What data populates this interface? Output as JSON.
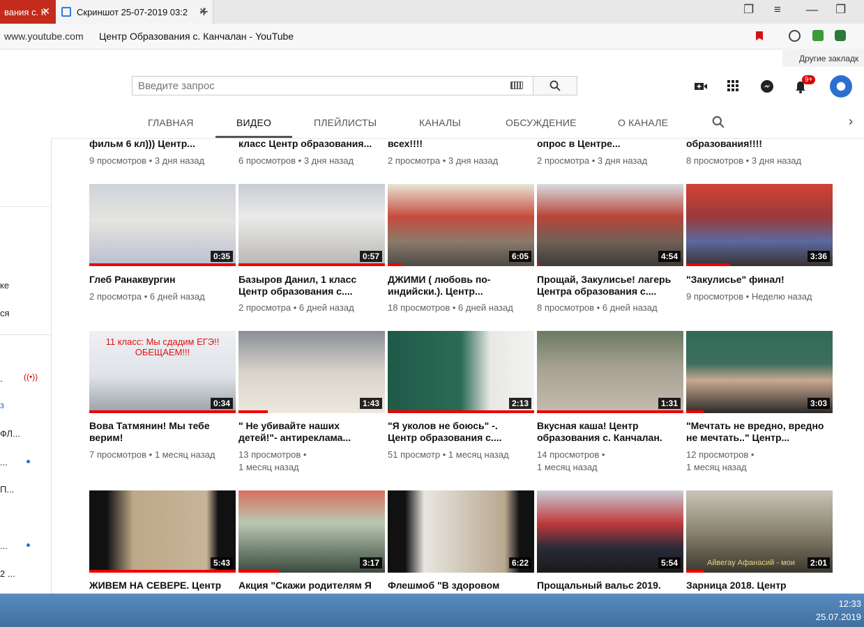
{
  "browser": {
    "tabs": [
      {
        "label": "вания с. К"
      },
      {
        "label": "Скриншот 25-07-2019 03:2"
      }
    ],
    "address": {
      "domain": "www.youtube.com",
      "title": "Центр Образования с. Канчалан - YouTube"
    },
    "other_bookmarks": "Другие закладк"
  },
  "masthead": {
    "search_placeholder": "Введите запрос",
    "notif_count": "9+"
  },
  "sidebar": {
    "items": [
      "ке",
      "ся",
      ".",
      "з",
      "ФЛ...",
      "...",
      "П...",
      "...",
      "2 ..."
    ]
  },
  "channel_tabs": [
    "ГЛАВНАЯ",
    "ВИДЕО",
    "ПЛЕЙЛИСТЫ",
    "КАНАЛЫ",
    "ОБСУЖДЕНИЕ",
    "О КАНАЛЕ"
  ],
  "partial_row": [
    {
      "title": "фильм 6 кл))) Центр...",
      "meta": "9 просмотров • 3 дня назад"
    },
    {
      "title": "класс Центр образования...",
      "meta": "6 просмотров • 3 дня назад"
    },
    {
      "title": "всех!!!!",
      "meta": "2 просмотра • 3 дня назад"
    },
    {
      "title": "опрос в Центре...",
      "meta": "2 просмотра • 3 дня назад"
    },
    {
      "title": "образования!!!!",
      "meta": "8 просмотров • 3 дня назад"
    }
  ],
  "row1": [
    {
      "duration": "0:35",
      "title1": "Глеб Ранаквургин",
      "title2": "",
      "meta1": "2 просмотра • 6 дней назад",
      "meta2": "",
      "progress": 1.0
    },
    {
      "duration": "0:57",
      "title1": "Базыров Данил, 1 класс",
      "title2": "Центр образования с....",
      "meta1": "2 просмотра • 6 дней назад",
      "meta2": "",
      "progress": 1.0
    },
    {
      "duration": "6:05",
      "title1": "ДЖИМИ ( любовь по-",
      "title2": "индийски.). Центр...",
      "meta1": "18 просмотров • 6 дней назад",
      "meta2": "",
      "progress": 0.1
    },
    {
      "duration": "4:54",
      "title1": "Прощай, Закулисье! лагерь",
      "title2": "Центра образования с....",
      "meta1": "8 просмотров • 6 дней назад",
      "meta2": "",
      "progress": 0.02
    },
    {
      "duration": "3:36",
      "title1": "\"Закулисье\" финал!",
      "title2": "",
      "meta1": "9 просмотров • Неделю назад",
      "meta2": "",
      "progress": 0.3
    }
  ],
  "row2": [
    {
      "duration": "0:34",
      "title1": "Вова Татмянин! Мы тебе",
      "title2": "верим!",
      "meta1": "7 просмотров • 1 месяц назад",
      "meta2": "",
      "progress": 1.0,
      "overlay": "11 класс: Мы сдадим ЕГЭ!! ОБЕЩАЕМ!!!"
    },
    {
      "duration": "1:43",
      "title1": "\" Не убивайте наших",
      "title2": "детей!\"- антиреклама...",
      "meta1": "13 просмотров •",
      "meta2": "1 месяц назад",
      "progress": 0.2
    },
    {
      "duration": "2:13",
      "title1": "\"Я уколов не боюсь\" -.",
      "title2": "Центр образования с....",
      "meta1": "51 просмотр • 1 месяц назад",
      "meta2": "",
      "progress": 1.0
    },
    {
      "duration": "1:31",
      "title1": "Вкусная каша! Центр",
      "title2": "образования с. Канчалан.",
      "meta1": "14 просмотров •",
      "meta2": "1 месяц назад",
      "progress": 1.0
    },
    {
      "duration": "3:03",
      "title1": "\"Мечтать не вредно, вредно",
      "title2": "не мечтать..\" Центр...",
      "meta1": "12 просмотров •",
      "meta2": "1 месяц назад",
      "progress": 0.12
    }
  ],
  "row3": [
    {
      "duration": "5:43",
      "title1": "ЖИВЕМ НА СЕВЕРЕ. Центр",
      "progress": 1.0
    },
    {
      "duration": "3:17",
      "title1": "Акция \"Скажи родителям Я",
      "progress": 0.28
    },
    {
      "duration": "6:22",
      "title1": "Флешмоб \"В здоровом",
      "progress": 0.0
    },
    {
      "duration": "5:54",
      "title1": "Прощальный вальс 2019.",
      "progress": 0.0
    },
    {
      "duration": "2:01",
      "title1": "Зарница 2018. Центр",
      "progress": 0.12,
      "overlay_small": "Айвегау Афанасий - мои"
    }
  ],
  "taskbar": {
    "time": "12:33",
    "date": "25.07.2019"
  }
}
